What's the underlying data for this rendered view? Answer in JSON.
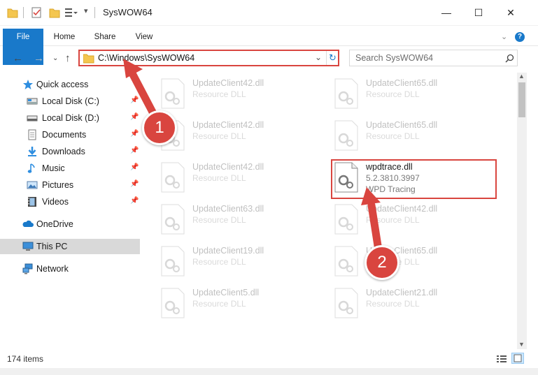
{
  "window": {
    "title": "SysWOW64",
    "controls": {
      "minimize": "—",
      "maximize": "☐",
      "close": "✕"
    }
  },
  "ribbon": {
    "tabs": [
      "File",
      "Home",
      "Share",
      "View"
    ],
    "help": "?"
  },
  "address": {
    "path": "C:\\Windows\\SysWOW64",
    "search_placeholder": "Search SysWOW64"
  },
  "sidebar": {
    "items": [
      {
        "label": "Quick access",
        "icon": "star-icon",
        "pinned": false
      },
      {
        "label": "Local Disk (C:)",
        "icon": "drive-icon",
        "pinned": true
      },
      {
        "label": "Local Disk (D:)",
        "icon": "drive-icon",
        "pinned": true
      },
      {
        "label": "Documents",
        "icon": "documents-icon",
        "pinned": true
      },
      {
        "label": "Downloads",
        "icon": "download-icon",
        "pinned": true
      },
      {
        "label": "Music",
        "icon": "music-icon",
        "pinned": true
      },
      {
        "label": "Pictures",
        "icon": "pictures-icon",
        "pinned": true
      },
      {
        "label": "Videos",
        "icon": "videos-icon",
        "pinned": true
      },
      {
        "label": "OneDrive",
        "icon": "cloud-icon",
        "pinned": false
      },
      {
        "label": "This PC",
        "icon": "computer-icon",
        "pinned": false,
        "selected": true
      },
      {
        "label": "Network",
        "icon": "network-icon",
        "pinned": false
      }
    ]
  },
  "files": {
    "left": [
      {
        "name": "UpdateClient42.dll",
        "type": "Resource DLL"
      },
      {
        "name": "UpdateClient42.dll",
        "type": "Resource DLL"
      },
      {
        "name": "UpdateClient42.dll",
        "type": "Resource DLL"
      },
      {
        "name": "UpdateClient63.dll",
        "type": "Resource DLL"
      },
      {
        "name": "UpdateClient19.dll",
        "type": "Resource DLL"
      },
      {
        "name": "UpdateClient5.dll",
        "type": "Resource DLL"
      }
    ],
    "right": [
      {
        "name": "UpdateClient65.dll",
        "type": "Resource DLL"
      },
      {
        "name": "UpdateClient65.dll",
        "type": "Resource DLL"
      },
      {
        "name": "wpdtrace.dll",
        "version": "5.2.3810.3997",
        "type": "WPD Tracing",
        "highlighted": true
      },
      {
        "name": "UpdateClient42.dll",
        "type": "Resource DLL"
      },
      {
        "name": "UpdateClient65.dll",
        "type": "Resource DLL"
      },
      {
        "name": "UpdateClient21.dll",
        "type": "Resource DLL"
      }
    ]
  },
  "status": {
    "item_count": "174 items"
  },
  "annotations": {
    "step1": "1",
    "step2": "2",
    "color": "#d9453f"
  },
  "colors": {
    "accent": "#1979ca",
    "highlight": "#d9453f"
  }
}
